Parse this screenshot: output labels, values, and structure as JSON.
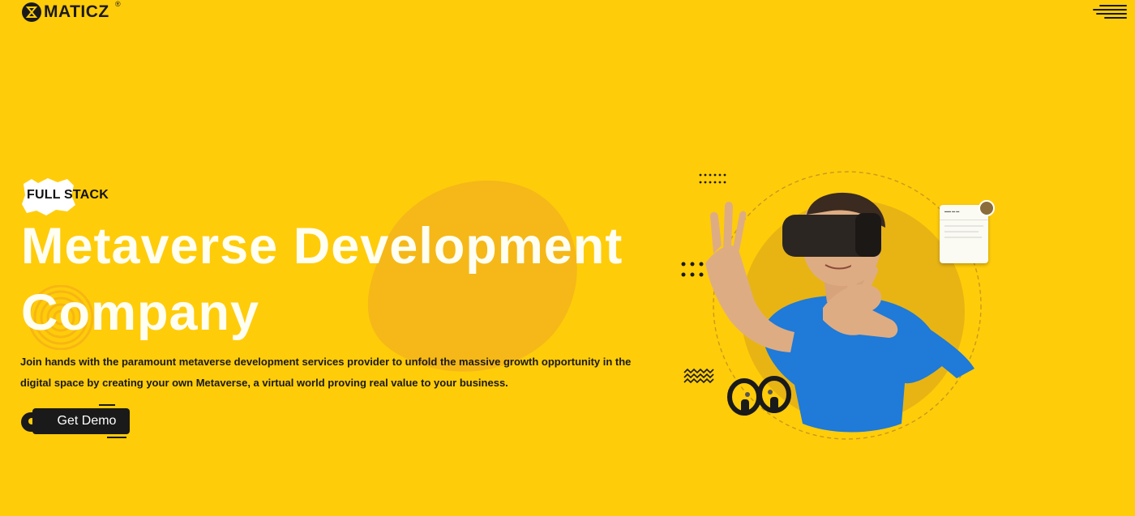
{
  "header": {
    "logo_text": "MATICZ",
    "logo_reg": "®",
    "logo_icon": "hourglass-logo-icon",
    "menu_icon": "hamburger-menu-icon"
  },
  "hero": {
    "badge": "FULL STACK",
    "title_line1": "Metaverse Development",
    "title_line2": "Company",
    "description_line1": "Join hands with the paramount metaverse development services provider to unfold the massive growth opportunity in the",
    "description_line2": "digital space by creating your own Metaverse, a virtual world proving real value to your business.",
    "cta_label": "Get Demo"
  },
  "colors": {
    "background": "#ffcc0a",
    "blob": "#f5b818",
    "dark": "#1a1a1a",
    "title": "#fffef2",
    "shirt": "#1f7ad8"
  },
  "illustration": {
    "subject": "vr-headset-person-illustration",
    "controllers_icon": "vr-controllers-icon",
    "chat_card_icon": "chat-card-icon"
  }
}
